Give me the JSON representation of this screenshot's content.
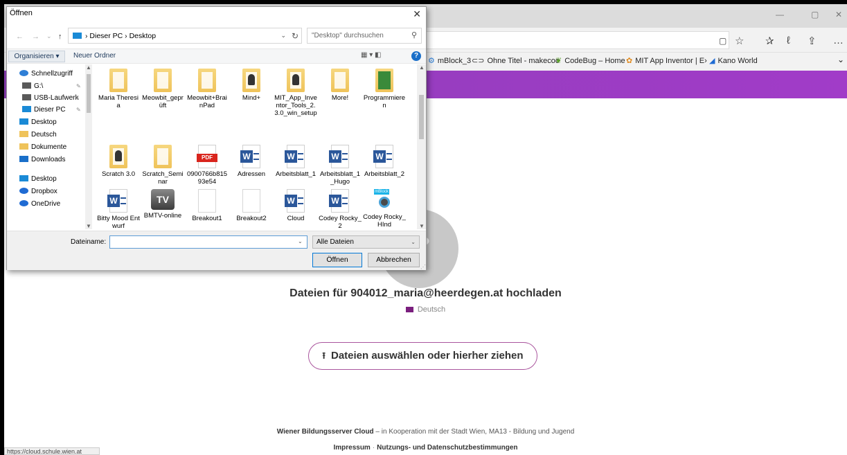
{
  "browser": {
    "window_controls": {
      "minimize": "—",
      "maximize": "▢",
      "close": "✕"
    },
    "toolbar_icons": {
      "reading": "▢",
      "favorite": "☆",
      "favorites_hub": "✰",
      "notes": "ℓ",
      "share": "⇪",
      "more": "…"
    },
    "favorites": [
      {
        "icon": "mblock-icon",
        "label": "mBlock_3"
      },
      {
        "icon": "makecode-icon",
        "label": "Ohne Titel - makecoc"
      },
      {
        "icon": "codebug-icon",
        "label": "CodeBug – Home"
      },
      {
        "icon": "appinventor-icon",
        "label": "MIT App Inventor | E›"
      },
      {
        "icon": "kano-icon",
        "label": "Kano World"
      }
    ],
    "favorites_overflow": "⌄",
    "accent_color": "#9b3cc2"
  },
  "page": {
    "upload_title": "Dateien für 904012_maria@heerdegen.at hochladen",
    "folder_label": "Deutsch",
    "upload_button": "Dateien auswählen oder hierher ziehen",
    "footer_brand": "Wiener Bildungsserver Cloud",
    "footer_text": " – in Kooperation mit der Stadt Wien, MA13 - Bildung und Jugend",
    "footer_impressum": "Impressum",
    "footer_sep": "·",
    "footer_privacy": "Nutzungs- und Datenschutzbestimmungen",
    "status_url": "https://cloud.schule.wien.at"
  },
  "dialog": {
    "title": "Öffnen",
    "close": "✕",
    "nav": {
      "back": "←",
      "forward": "→",
      "recent": "⌄",
      "up": "↑"
    },
    "path": "›  Dieser PC  ›  Desktop",
    "path_drop": "⌄",
    "refresh": "↻",
    "search_placeholder": "\"Desktop\" durchsuchen",
    "search_icon": "⚲",
    "organize": "Organisieren ▾",
    "new_folder": "Neuer Ordner",
    "view_icons": "▦ ▾  ◧",
    "help": "?",
    "nav_items": [
      {
        "label": "Schnellzugriff",
        "icon": "star-icon",
        "color": "#2f7fd6",
        "pinned": false
      },
      {
        "label": "G:\\",
        "icon": "drive-icon",
        "color": "#5a5a5a",
        "pinned": true
      },
      {
        "label": "USB-Laufwerk",
        "icon": "usb-drive-icon",
        "color": "#5a5a5a",
        "pinned": true
      },
      {
        "label": "Dieser PC",
        "icon": "computer-icon",
        "color": "#1a8ad6",
        "pinned": true
      },
      {
        "label": "Desktop",
        "icon": "desktop-icon",
        "color": "#1a8ad6",
        "pinned": false
      },
      {
        "label": "Deutsch",
        "icon": "folder-icon",
        "color": "#efc35a",
        "pinned": false
      },
      {
        "label": "Dokumente",
        "icon": "folder-icon",
        "color": "#efc35a",
        "pinned": false
      },
      {
        "label": "Downloads",
        "icon": "download-icon",
        "color": "#1a6fc9",
        "pinned": false
      },
      {
        "label": "Desktop",
        "icon": "desktop-icon",
        "color": "#1a8ad6",
        "pinned": false
      },
      {
        "label": "Dropbox",
        "icon": "dropbox-icon",
        "color": "#1f6bd3",
        "pinned": false
      },
      {
        "label": "OneDrive",
        "icon": "onedrive-icon",
        "color": "#1f6bd3",
        "pinned": false
      }
    ],
    "files": [
      {
        "label": "Maria Theresia",
        "kind": "folder"
      },
      {
        "label": "Meowbit_geprüft",
        "kind": "folder"
      },
      {
        "label": "Meowbit+BrainPad",
        "kind": "folder"
      },
      {
        "label": "Mind+",
        "kind": "folder-mascot"
      },
      {
        "label": "MIT_App_Inventor_Tools_2.3.0_win_setup",
        "kind": "folder-mascot"
      },
      {
        "label": "More!",
        "kind": "folder"
      },
      {
        "label": "Programmieren",
        "kind": "folder-green"
      },
      {
        "label": "Scratch 3.0",
        "kind": "folder-mascot"
      },
      {
        "label": "Scratch_Seminar",
        "kind": "folder"
      },
      {
        "label": "0900766b81593e54",
        "kind": "pdf"
      },
      {
        "label": "Adressen",
        "kind": "word"
      },
      {
        "label": "Arbeitsblatt_1",
        "kind": "word"
      },
      {
        "label": "Arbeitsblatt_1_Hugo",
        "kind": "word"
      },
      {
        "label": "Arbeitsblatt_2",
        "kind": "word"
      },
      {
        "label": "Bitty Mood Entwurf",
        "kind": "word"
      },
      {
        "label": "BMTV-online",
        "kind": "tv"
      },
      {
        "label": "Breakout1",
        "kind": "blank"
      },
      {
        "label": "Breakout2",
        "kind": "blank"
      },
      {
        "label": "Cloud",
        "kind": "word"
      },
      {
        "label": "Codey Rocky_2",
        "kind": "word"
      },
      {
        "label": "Codey Rocky_HInd",
        "kind": "mblock"
      }
    ],
    "filename_label": "Dateiname:",
    "filename_value": "",
    "filetype": "Alle Dateien",
    "open_button": "Öffnen",
    "cancel_button": "Abbrechen",
    "dropdown_glyph": "⌄",
    "grip": "⋰"
  }
}
